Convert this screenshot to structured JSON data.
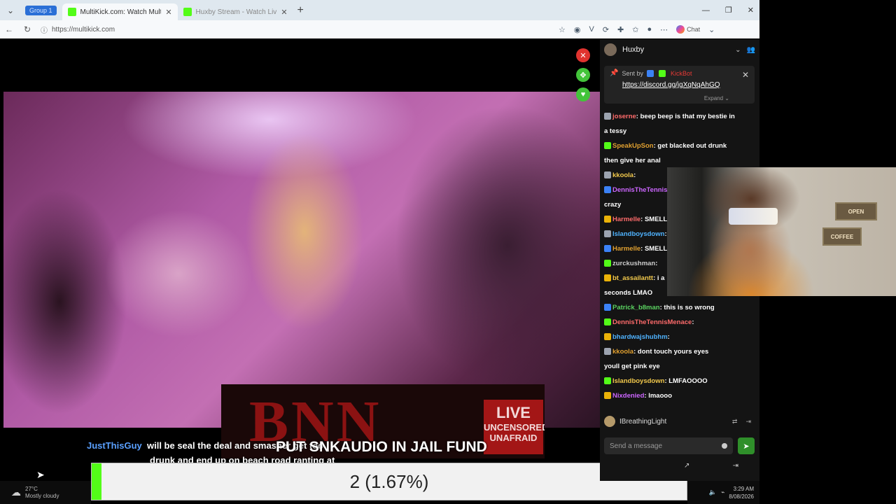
{
  "browser": {
    "group_label": "Group 1",
    "tabs": [
      {
        "title": "MultiKick.com: Watch Multiple Str"
      },
      {
        "title": "Huxby Stream - Watch Live on Ki"
      }
    ],
    "url": "https://multikick.com",
    "chat_label": "Chat"
  },
  "video": {
    "banner_brand": "BNN",
    "live_title": "LIVE",
    "live_line1": "UNCENSORED",
    "live_line2": "UNAFRAID",
    "ticker": "PUT SNKAUDIO IN JAIL FUND",
    "overlay_user": "JustThisGuy",
    "overlay_line1": "will be seal the deal and smasher get too",
    "overlay_line2": "drunk and end up on beach road ranting at"
  },
  "poll": {
    "label": "2 (1.67%)",
    "fill_fraction": 0.0167
  },
  "taskbar": {
    "temp": "27°C",
    "condition": "Mostly cloudy",
    "time": "3:29 AM",
    "date": "8/08/2026"
  },
  "chat": {
    "channel": "Huxby",
    "pinned": {
      "sent_by_label": "Sent by",
      "sender": "KickBot",
      "link": "https://discord.gg/jgXqNqAhGQ",
      "expand": "Expand"
    },
    "messages": [
      {
        "user": "joserne",
        "text": "beep beep is that my bestie in"
      },
      {
        "user": "",
        "text": "a tessy"
      },
      {
        "user": "SpeakUpSon",
        "text": "get blacked out drunk"
      },
      {
        "user": "",
        "text": "then give her anal"
      },
      {
        "user": "kkoola",
        "text": ""
      },
      {
        "user": "DennisTheTennis",
        "text": ""
      },
      {
        "user": "",
        "text": "crazy"
      },
      {
        "user": "Harmelle",
        "text": "SMELL IT"
      },
      {
        "user": "Islandboysdown",
        "text": ""
      },
      {
        "user": "Harmelle",
        "text": "SMELL IT"
      },
      {
        "user": "zurckushman",
        "text": ""
      },
      {
        "user": "bt_assailantt",
        "text": "i a"
      },
      {
        "user": "",
        "text": "seconds LMAO"
      },
      {
        "user": "Patrick_b8man",
        "text": "this is so wrong"
      },
      {
        "user": "DennisTheTennisMenace",
        "text": ""
      },
      {
        "user": "bhardwajshubhm",
        "text": ""
      },
      {
        "user": "kkoola",
        "text": "dont touch yours eyes"
      },
      {
        "user": "",
        "text": "youll get pink eye"
      },
      {
        "user": "Islandboysdown",
        "text": "LMFAOOOO"
      },
      {
        "user": "Nixdenied",
        "text": "lmaooo"
      }
    ],
    "current_user": "IBreathingLight",
    "send_placeholder": "Send a message"
  },
  "webcam": {
    "sign1": "OPEN",
    "sign2": "COFFEE"
  },
  "colors": {
    "kick_green": "#53fc18",
    "close_red": "#e0332f",
    "chat_bg": "#141414"
  }
}
